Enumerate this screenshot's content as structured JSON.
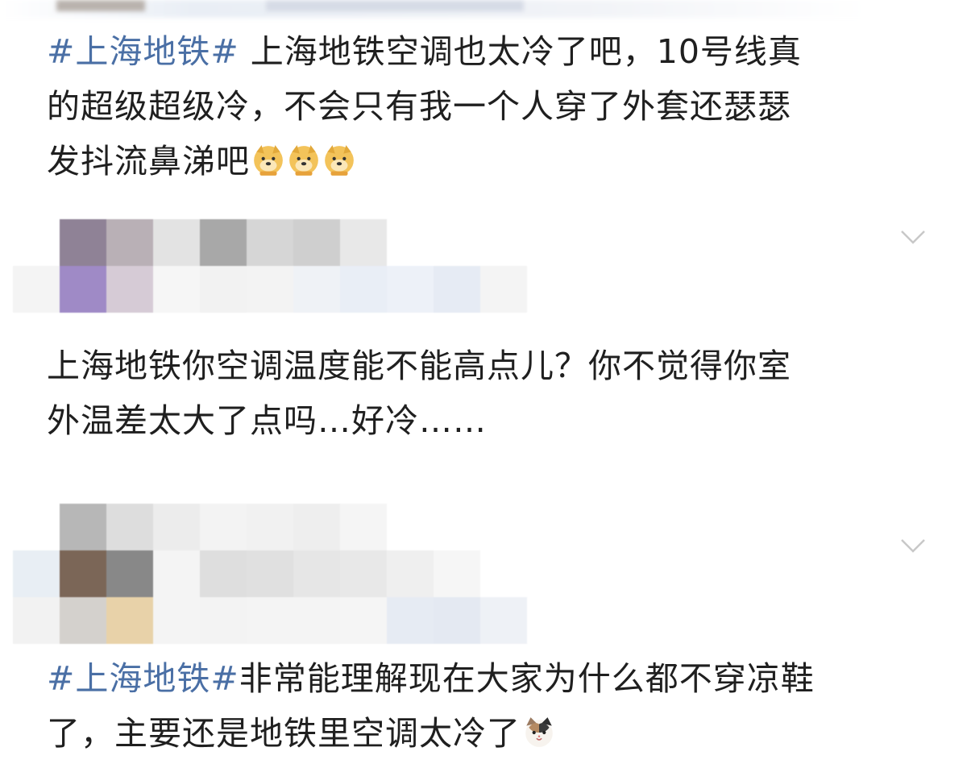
{
  "posts": [
    {
      "hashtag": "#上海地铁#",
      "line1_rest": " 上海地铁空调也太冷了吧，10号线真",
      "line2": "的超级超级冷，不会只有我一个人穿了外套还瑟瑟",
      "line3": "发抖流鼻涕吧",
      "emojis": [
        "doge-emoji",
        "doge-emoji",
        "doge-emoji"
      ]
    },
    {
      "line1": "上海地铁你空调温度能不能高点儿？你不觉得你室",
      "line2": "外温差太大了点吗…好冷……"
    },
    {
      "hashtag": "#上海地铁#",
      "line1_rest": "非常能理解现在大家为什么都不穿凉鞋",
      "line2": "了，主要还是地铁里空调太冷了",
      "emojis": [
        "cat-emoji"
      ]
    }
  ],
  "icons": {
    "expand": "chevron-down-icon"
  },
  "colors": {
    "hashtag": "#4a6fa5",
    "text": "#1f1f1f",
    "chevron": "#c8c8c8"
  }
}
